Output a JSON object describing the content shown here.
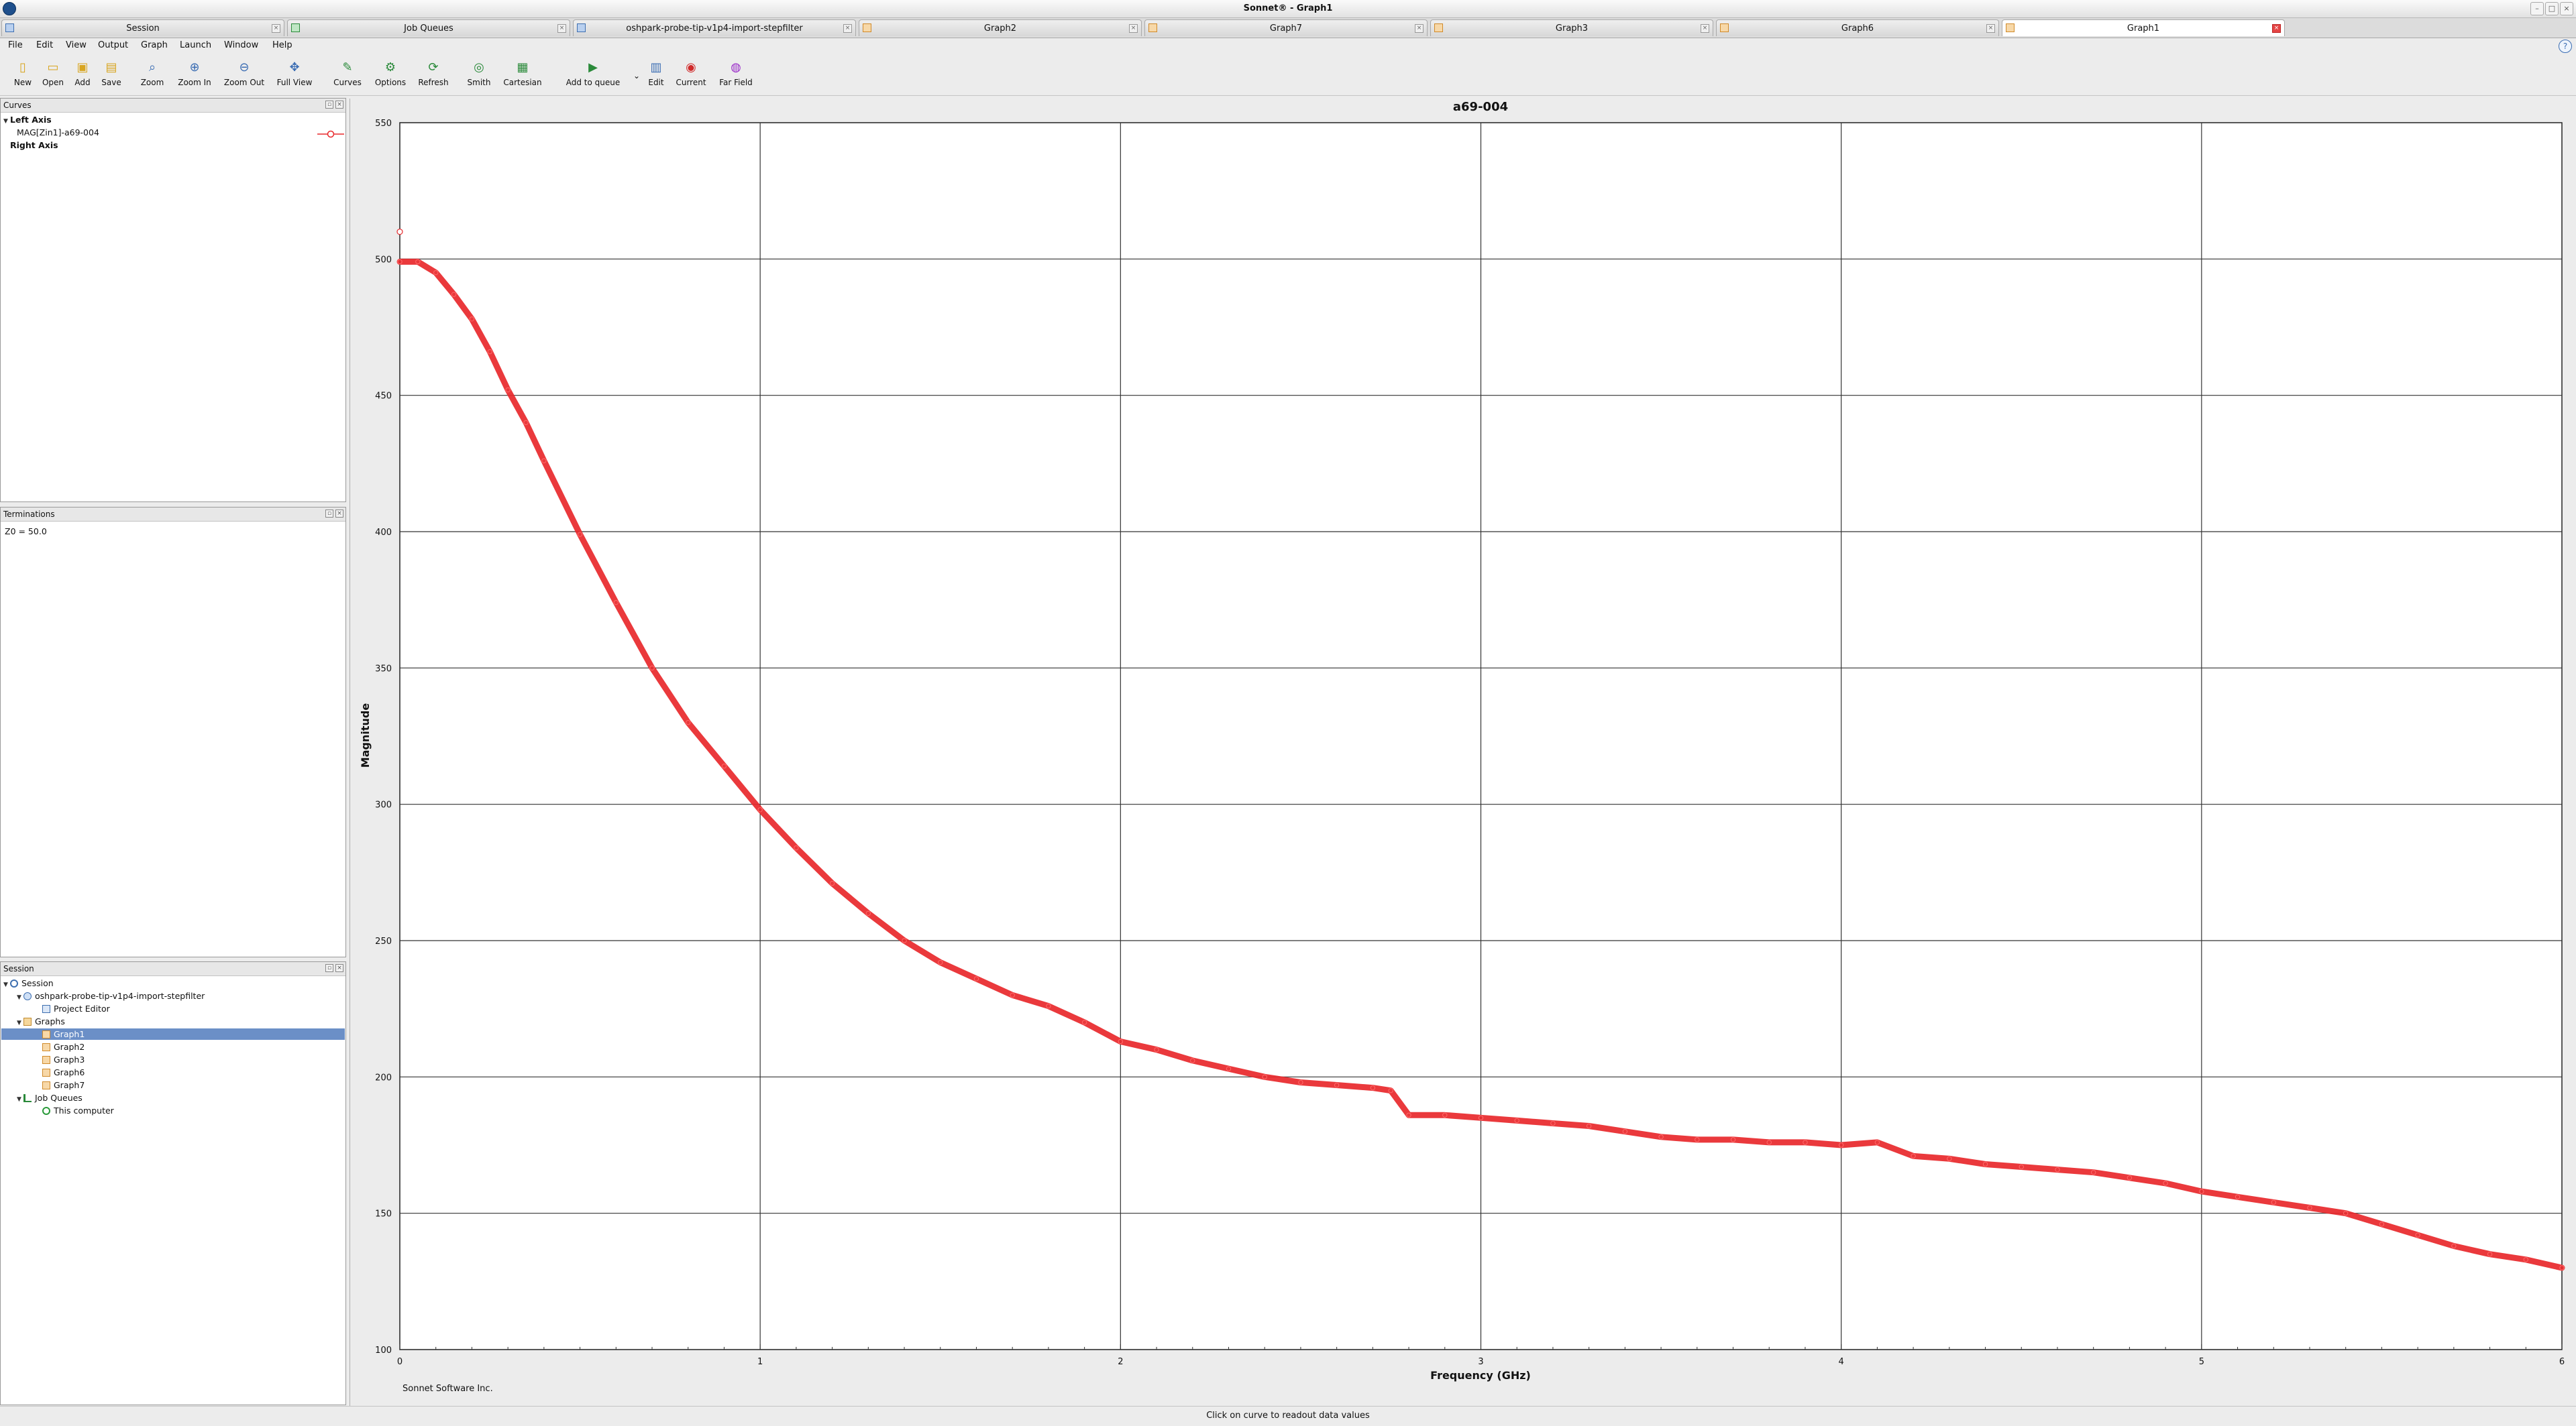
{
  "window": {
    "title": "Sonnet® - Graph1"
  },
  "doc_tabs": [
    {
      "label": "Session",
      "icon": "session-icon",
      "active": false
    },
    {
      "label": "Job Queues",
      "icon": "job-queue-icon",
      "active": false
    },
    {
      "label": "oshpark-probe-tip-v1p4-import-stepfilter",
      "icon": "project-icon",
      "active": false
    },
    {
      "label": "Graph2",
      "icon": "graph-icon",
      "active": false
    },
    {
      "label": "Graph7",
      "icon": "graph-icon",
      "active": false
    },
    {
      "label": "Graph3",
      "icon": "graph-icon",
      "active": false
    },
    {
      "label": "Graph6",
      "icon": "graph-icon",
      "active": false
    },
    {
      "label": "Graph1",
      "icon": "graph-icon",
      "active": true
    }
  ],
  "menu": [
    "File",
    "Edit",
    "View",
    "Output",
    "Graph",
    "Launch",
    "Window",
    "Help"
  ],
  "toolbar": [
    {
      "label": "New",
      "icon": "new-icon"
    },
    {
      "label": "Open",
      "icon": "open-icon"
    },
    {
      "label": "Add",
      "icon": "add-icon"
    },
    {
      "label": "Save",
      "icon": "save-icon"
    },
    {
      "label": "Zoom",
      "icon": "zoom-icon"
    },
    {
      "label": "Zoom In",
      "icon": "zoom-in-icon"
    },
    {
      "label": "Zoom Out",
      "icon": "zoom-out-icon"
    },
    {
      "label": "Full View",
      "icon": "full-view-icon"
    },
    {
      "label": "Curves",
      "icon": "curves-icon"
    },
    {
      "label": "Options",
      "icon": "options-icon"
    },
    {
      "label": "Refresh",
      "icon": "refresh-icon"
    },
    {
      "label": "Smith",
      "icon": "smith-icon"
    },
    {
      "label": "Cartesian",
      "icon": "cartesian-icon"
    },
    {
      "label": "Add to queue",
      "icon": "add-to-queue-icon"
    },
    {
      "label": "Edit",
      "icon": "edit-icon"
    },
    {
      "label": "Current",
      "icon": "current-icon"
    },
    {
      "label": "Far Field",
      "icon": "far-field-icon"
    }
  ],
  "curves_panel": {
    "title": "Curves",
    "left_axis": "Left Axis",
    "curve_name": "MAG[Zin1]-a69-004",
    "right_axis": "Right Axis",
    "curve_color": "#e8282b"
  },
  "terminations_panel": {
    "title": "Terminations",
    "text": "Z0 = 50.0"
  },
  "session_panel": {
    "title": "Session",
    "session": "Session",
    "project": "oshpark-probe-tip-v1p4-import-stepfilter",
    "project_editor": "Project Editor",
    "graphs_folder": "Graphs",
    "graphs": [
      "Graph1",
      "Graph2",
      "Graph3",
      "Graph6",
      "Graph7"
    ],
    "selected_graph": "Graph1",
    "job_queues": "Job Queues",
    "this_computer": "This computer"
  },
  "status_bar": "Click on curve to readout data values",
  "footer": "Sonnet Software Inc.",
  "chart_data": {
    "type": "line",
    "title": "a69-004",
    "xlabel": "Frequency (GHz)",
    "ylabel": "Magnitude",
    "xlim": [
      0,
      6
    ],
    "ylim": [
      100,
      550
    ],
    "xticks": [
      0,
      1,
      2,
      3,
      4,
      5,
      6
    ],
    "yticks": [
      100,
      150,
      200,
      250,
      300,
      350,
      400,
      450,
      500,
      550
    ],
    "grid": true,
    "series": [
      {
        "name": "MAG[Zin1]-a69-004",
        "color": "#e8282b",
        "x": [
          0,
          0.05,
          0.1,
          0.15,
          0.2,
          0.25,
          0.3,
          0.35,
          0.4,
          0.5,
          0.6,
          0.7,
          0.8,
          0.9,
          1.0,
          1.1,
          1.2,
          1.3,
          1.4,
          1.5,
          1.6,
          1.7,
          1.8,
          1.9,
          2.0,
          2.1,
          2.2,
          2.3,
          2.4,
          2.5,
          2.6,
          2.7,
          2.75,
          2.8,
          2.9,
          3.0,
          3.1,
          3.2,
          3.3,
          3.4,
          3.5,
          3.6,
          3.7,
          3.8,
          3.9,
          4.0,
          4.1,
          4.2,
          4.3,
          4.4,
          4.5,
          4.6,
          4.7,
          4.8,
          4.9,
          5.0,
          5.1,
          5.2,
          5.3,
          5.4,
          5.5,
          5.6,
          5.7,
          5.8,
          5.9,
          6.0
        ],
        "y": [
          499,
          499,
          495,
          487,
          478,
          466,
          452,
          440,
          426,
          399,
          374,
          350,
          330,
          314,
          298,
          284,
          271,
          260,
          250,
          242,
          236,
          230,
          226,
          220,
          213,
          210,
          206,
          203,
          200,
          198,
          197,
          196,
          195,
          186,
          186,
          185,
          184,
          183,
          182,
          180,
          178,
          177,
          177,
          176,
          176,
          175,
          176,
          171,
          170,
          168,
          167,
          166,
          165,
          163,
          161,
          158,
          156,
          154,
          152,
          150,
          146,
          142,
          138,
          135,
          133,
          130
        ]
      }
    ]
  }
}
